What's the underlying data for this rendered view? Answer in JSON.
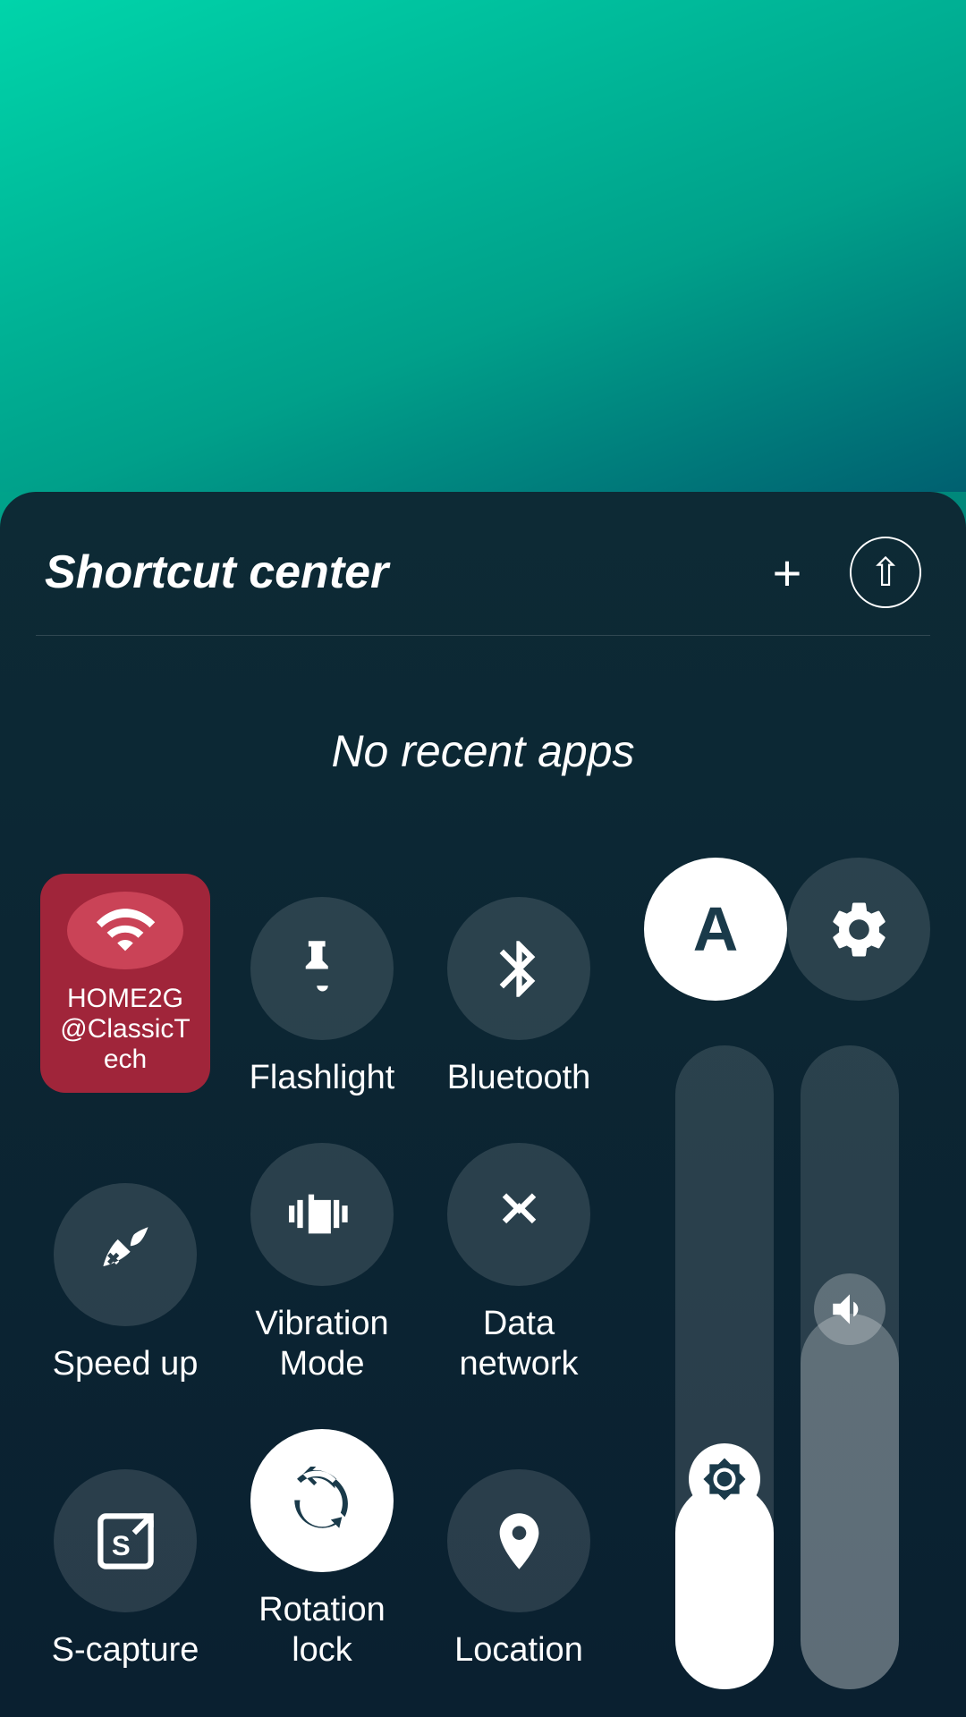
{
  "background": {
    "gradient_start": "#00c9a0",
    "gradient_end": "#005f6e"
  },
  "panel": {
    "title": "Shortcut center",
    "no_recent_apps": "No recent apps",
    "add_label": "+",
    "collapse_label": "^"
  },
  "shortcuts": [
    {
      "id": "wifi",
      "label": "HOME2G@ClassicTech",
      "icon": "wifi",
      "active": true,
      "type": "wifi-card"
    },
    {
      "id": "flashlight",
      "label": "Flashlight",
      "icon": "flashlight",
      "active": false
    },
    {
      "id": "bluetooth",
      "label": "Bluetooth",
      "icon": "bluetooth",
      "active": false
    },
    {
      "id": "speedup",
      "label": "Speed up",
      "icon": "rocket",
      "active": false
    },
    {
      "id": "vibration",
      "label": "Vibration Mode",
      "icon": "vibration",
      "active": false
    },
    {
      "id": "datanetwork",
      "label": "Data network",
      "icon": "data",
      "active": false
    },
    {
      "id": "scapture",
      "label": "S-capture",
      "icon": "scapture",
      "active": false
    },
    {
      "id": "rotationlock",
      "label": "Rotation lock",
      "icon": "rotation",
      "active": true,
      "type": "white-circle"
    },
    {
      "id": "location",
      "label": "Location",
      "icon": "location",
      "active": false
    }
  ],
  "sliders": {
    "brightness_pct": 32,
    "volume_pct": 58
  },
  "top_right_icons": [
    {
      "id": "font",
      "label": "A",
      "type": "font"
    },
    {
      "id": "settings",
      "label": "⚙",
      "type": "settings"
    }
  ]
}
